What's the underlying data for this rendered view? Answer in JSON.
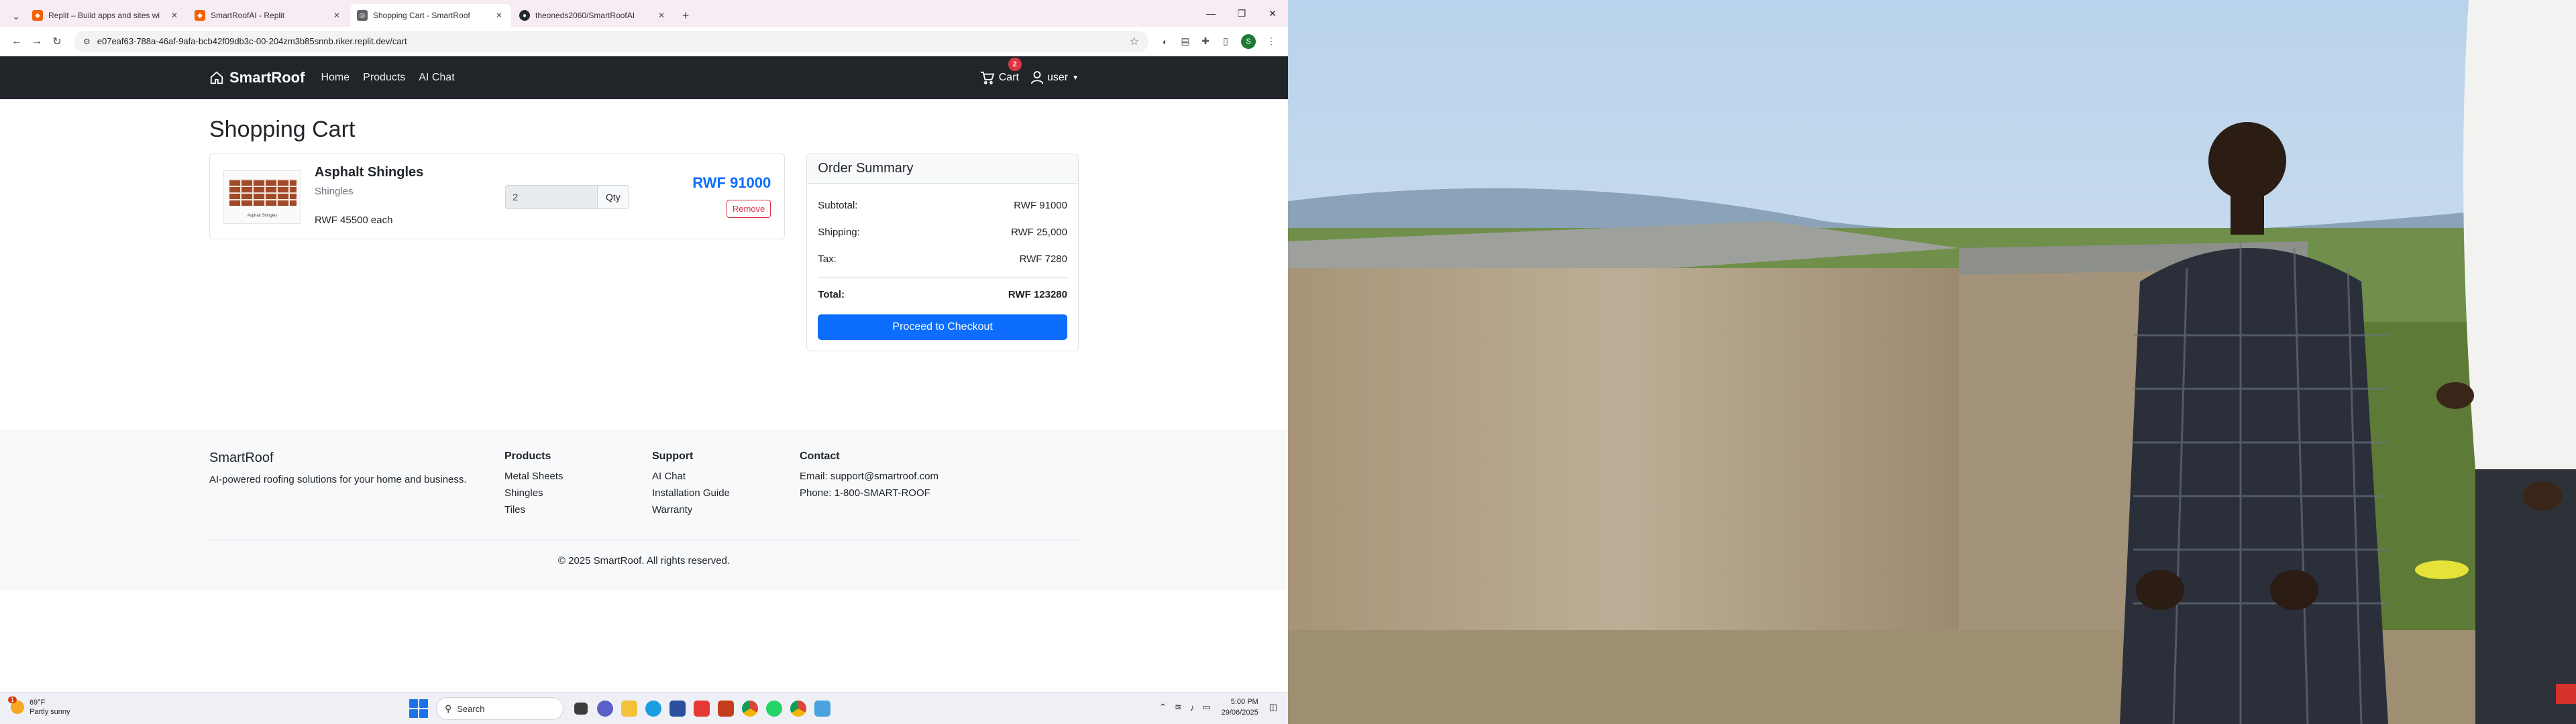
{
  "browser": {
    "tabs": [
      {
        "title": "Replit – Build apps and sites wi",
        "favicon_color": "#f26207",
        "active": false
      },
      {
        "title": "SmartRoofAI - Replit",
        "favicon_color": "#f26207",
        "active": false
      },
      {
        "title": "Shopping Cart - SmartRoof",
        "favicon_color": "#5f6368",
        "active": true
      },
      {
        "title": "theoneds2060/SmartRoofAI",
        "favicon_color": "#24292f",
        "active": false
      }
    ],
    "url": "e07eaf63-788a-46af-9afa-bcb42f09db3c-00-204zm3b85snnb.riker.replit.dev/cart",
    "profile_initial": "S"
  },
  "navbar": {
    "brand": "SmartRoof",
    "links": [
      "Home",
      "Products",
      "AI Chat"
    ],
    "cart_label": "Cart",
    "cart_count": "2",
    "user_label": "user"
  },
  "cart": {
    "title": "Shopping Cart",
    "items": [
      {
        "name": "Asphalt Shingles",
        "category": "Shingles",
        "unit_price": "RWF 45500 each",
        "quantity": "2",
        "qty_label": "Qty",
        "line_total": "RWF 91000",
        "remove_label": "Remove",
        "thumb_caption": "Asphalt Shingles"
      }
    ]
  },
  "summary": {
    "title": "Order Summary",
    "rows": [
      {
        "label": "Subtotal:",
        "value": "RWF 91000"
      },
      {
        "label": "Shipping:",
        "value": "RWF 25,000"
      },
      {
        "label": "Tax:",
        "value": "RWF 7280"
      }
    ],
    "total_label": "Total:",
    "total_value": "RWF 123280",
    "checkout_label": "Proceed to Checkout"
  },
  "footer": {
    "brand": "SmartRoof",
    "tagline": "AI-powered roofing solutions for your home and business.",
    "products_heading": "Products",
    "products": [
      "Metal Sheets",
      "Shingles",
      "Tiles"
    ],
    "support_heading": "Support",
    "support": [
      "AI Chat",
      "Installation Guide",
      "Warranty"
    ],
    "contact_heading": "Contact",
    "email": "Email: support@smartroof.com",
    "phone": "Phone: 1-800-SMART-ROOF",
    "copyright": "© 2025 SmartRoof. All rights reserved."
  },
  "taskbar": {
    "weather_temp": "69°F",
    "weather_desc": "Partly sunny",
    "weather_badge": "1",
    "search_placeholder": "Search",
    "time": "5:00 PM",
    "date": "29/06/2025"
  },
  "colors": {
    "navbar_bg": "#212529",
    "primary": "#0d6efd",
    "danger": "#dc3545"
  }
}
